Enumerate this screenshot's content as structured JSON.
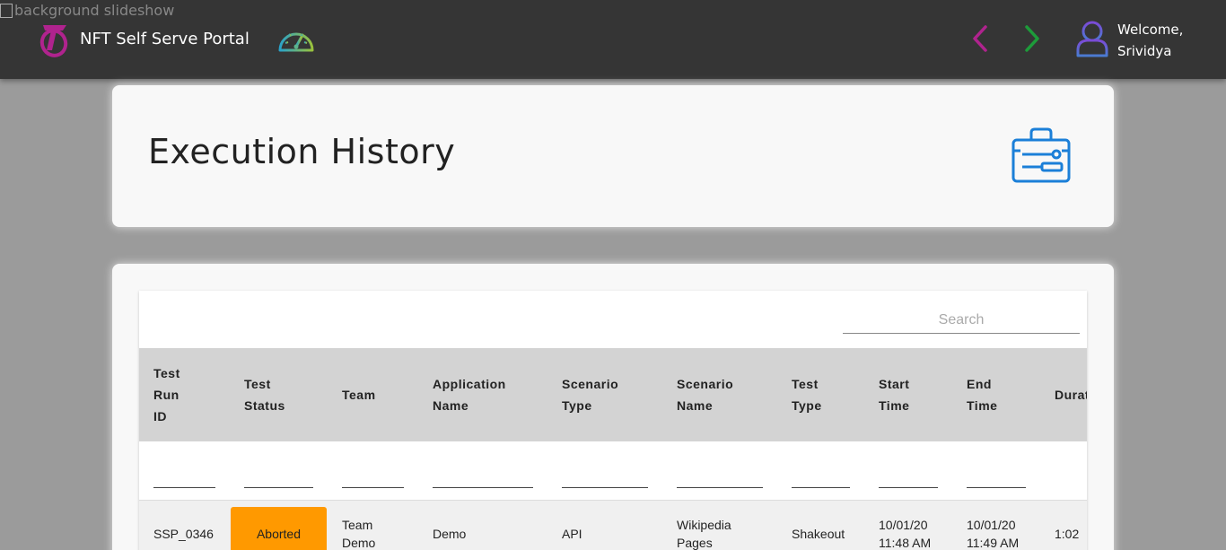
{
  "broken_image_alt": "background slideshow",
  "header": {
    "brand": "NFT Self Serve Portal",
    "welcome_line1": "Welcome,",
    "welcome_line2": "Srividya",
    "icons": [
      "telstra-logo-icon",
      "speedometer-icon",
      "chevron-left-icon",
      "chevron-right-icon",
      "user-avatar-icon"
    ]
  },
  "page": {
    "title": "Execution History",
    "title_icon": "toolbox-icon"
  },
  "table": {
    "search_placeholder": "Search",
    "columns": [
      {
        "line1": "Test",
        "line2": "Run",
        "line3": "ID"
      },
      {
        "line1": "Test",
        "line2": "Status",
        "line3": ""
      },
      {
        "line1": "Team",
        "line2": "",
        "line3": ""
      },
      {
        "line1": "Application",
        "line2": "Name",
        "line3": ""
      },
      {
        "line1": "Scenario",
        "line2": "Type",
        "line3": ""
      },
      {
        "line1": "Scenario",
        "line2": "Name",
        "line3": ""
      },
      {
        "line1": "Test",
        "line2": "Type",
        "line3": ""
      },
      {
        "line1": "Start",
        "line2": "Time",
        "line3": ""
      },
      {
        "line1": "End",
        "line2": "Time",
        "line3": ""
      },
      {
        "line1": "Durat",
        "line2": "",
        "line3": ""
      }
    ],
    "rows": [
      {
        "run_id": "SSP_0346",
        "status": "Aborted",
        "status_color": "#ff9900",
        "team_l1": "Team",
        "team_l2": "Demo",
        "application": "Demo",
        "scenario_type": "API",
        "scenario_name_l1": "Wikipedia",
        "scenario_name_l2": "Pages",
        "test_type": "Shakeout",
        "start_l1": "10/01/20",
        "start_l2": "11:48 AM",
        "end_l1": "10/01/20",
        "end_l2": "11:49 AM",
        "duration": "1:02"
      }
    ]
  }
}
